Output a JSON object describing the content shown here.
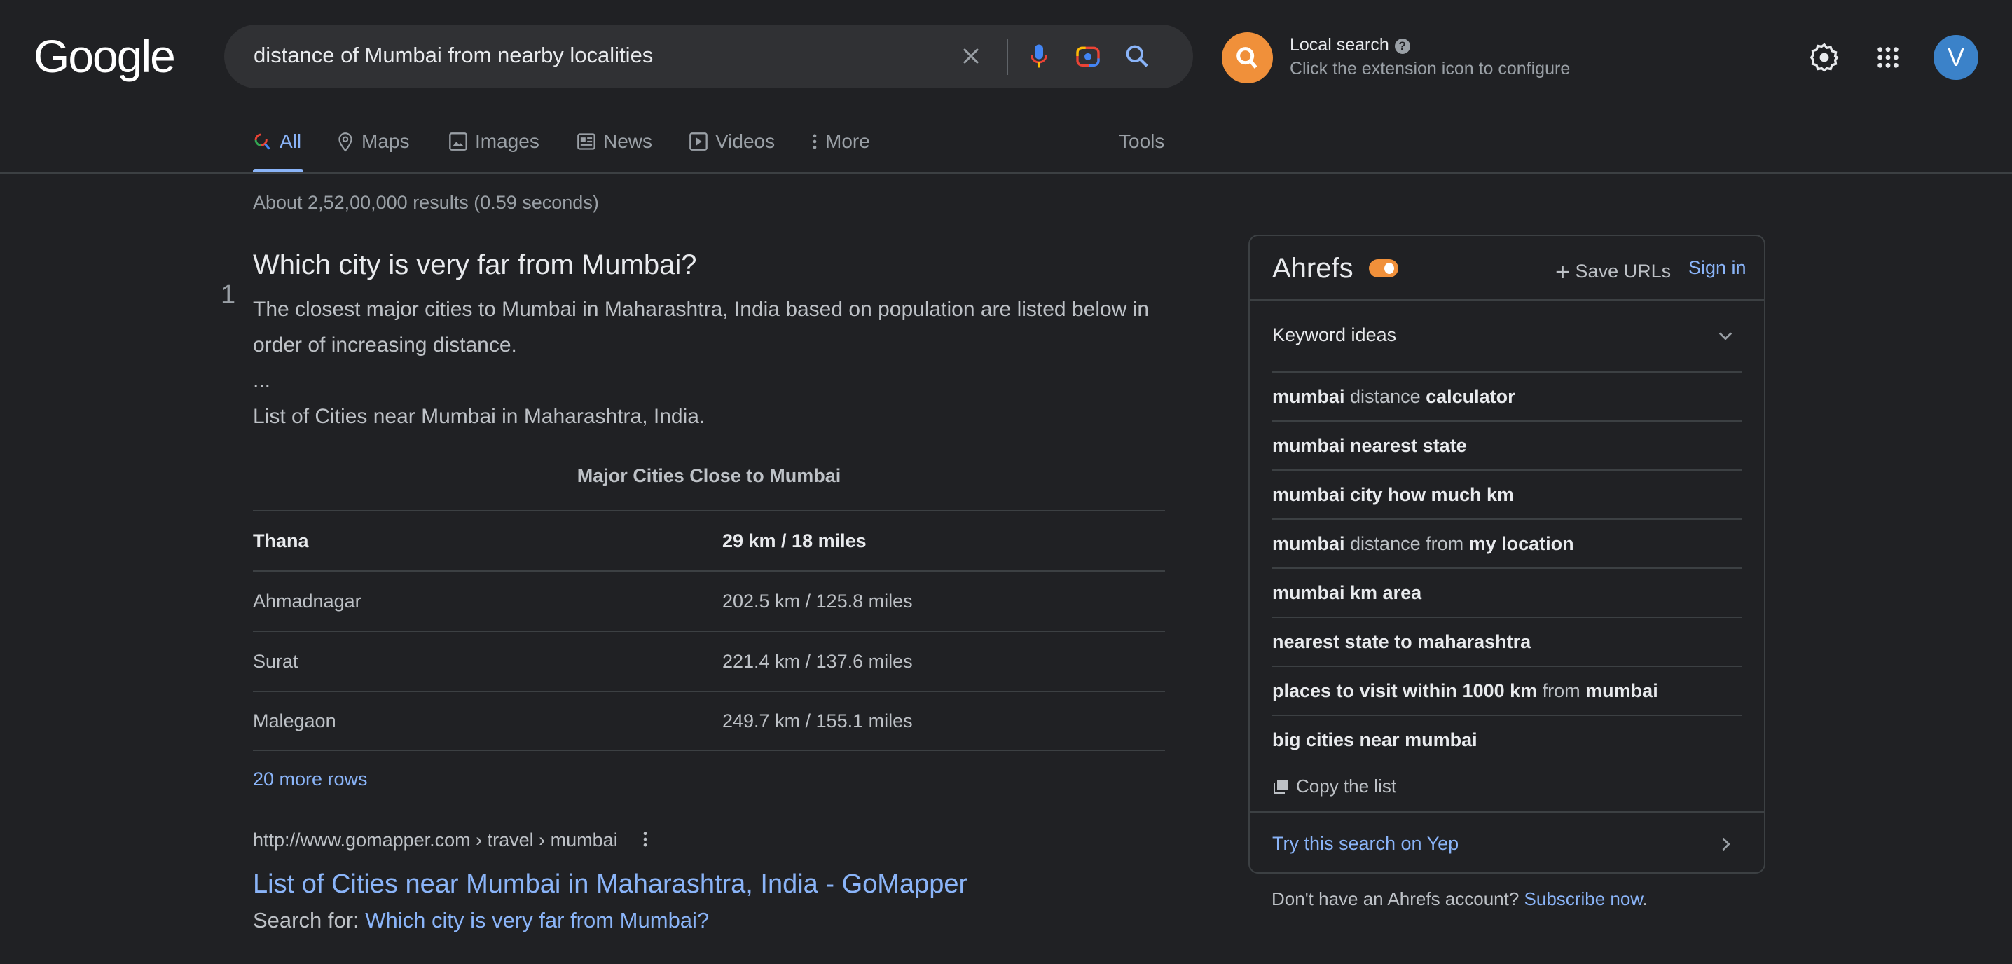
{
  "header": {
    "logo": "Google",
    "query": "distance of Mumbai from nearby localities",
    "local_search": {
      "title": "Local search",
      "subtitle": "Click the extension icon to configure"
    },
    "avatar_letter": "V"
  },
  "tabs": [
    {
      "label": "All",
      "icon": "search-icon",
      "active": true
    },
    {
      "label": "Maps",
      "icon": "map-pin-icon"
    },
    {
      "label": "Images",
      "icon": "image-icon"
    },
    {
      "label": "News",
      "icon": "news-icon"
    },
    {
      "label": "Videos",
      "icon": "play-icon"
    },
    {
      "label": "More",
      "icon": "more-vert-icon"
    }
  ],
  "tools_label": "Tools",
  "results_count": "About 2,52,00,000 results (0.59 seconds)",
  "snippet": {
    "number": "1",
    "question": "Which city is very far from Mumbai?",
    "paragraph": "The closest major cities to Mumbai in Maharashtra, India based on population are listed below in order of increasing distance.",
    "ellipsis": "...",
    "list_title": "List of Cities near Mumbai in Maharashtra, India.",
    "table_caption": "Major Cities Close to Mumbai",
    "rows": [
      {
        "city": "Thana",
        "distance": "29 km / 18 miles"
      },
      {
        "city": "Ahmadnagar",
        "distance": "202.5 km / 125.8 miles"
      },
      {
        "city": "Surat",
        "distance": "221.4 km / 137.6 miles"
      },
      {
        "city": "Malegaon",
        "distance": "249.7 km / 155.1 miles"
      }
    ],
    "more_rows": "20 more rows",
    "url": "http://www.gomapper.com › travel › mumbai",
    "title": "List of Cities near Mumbai in Maharashtra, India - GoMapper",
    "search_for_label": "Search for:",
    "search_for_link": "Which city is very far from Mumbai?"
  },
  "ahrefs": {
    "title": "Ahrefs",
    "toggle_on": true,
    "save_urls": "Save URLs",
    "sign_in": "Sign in",
    "keyword_ideas": "Keyword ideas",
    "keywords": [
      [
        {
          "t": "mumbai",
          "b": true
        },
        {
          "t": " distance ",
          "b": false
        },
        {
          "t": "calculator",
          "b": true
        }
      ],
      [
        {
          "t": "mumbai nearest state",
          "b": true
        }
      ],
      [
        {
          "t": "mumbai city how much km",
          "b": true
        }
      ],
      [
        {
          "t": "mumbai",
          "b": true
        },
        {
          "t": " distance from ",
          "b": false
        },
        {
          "t": "my location",
          "b": true
        }
      ],
      [
        {
          "t": "mumbai km area",
          "b": true
        }
      ],
      [
        {
          "t": "nearest state to maharashtra",
          "b": true
        }
      ],
      [
        {
          "t": "places to visit within 1000 km",
          "b": true
        },
        {
          "t": " from ",
          "b": false
        },
        {
          "t": "mumbai",
          "b": true
        }
      ],
      [
        {
          "t": "big cities near mumbai",
          "b": true
        }
      ]
    ],
    "copy_list": "Copy the list",
    "yep": "Try this search on Yep",
    "footer_text": "Don't have an Ahrefs account?",
    "footer_link": "Subscribe now",
    "footer_end": "."
  },
  "colors": {
    "background": "#202124",
    "link": "#8ab4f8",
    "accent": "#f0903a",
    "avatar": "#3b82c9"
  }
}
